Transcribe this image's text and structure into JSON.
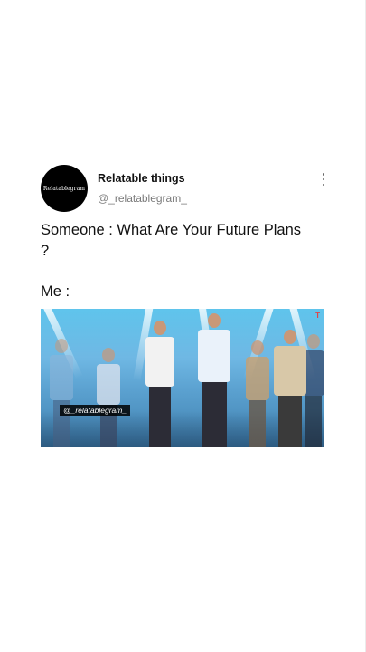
{
  "post": {
    "avatar_text": "Relatablegram",
    "display_name": "Relatable things",
    "handle": "@_relatablegram_",
    "text_line1": "Someone : What Are Your Future Plans ?",
    "text_line2": "Me :",
    "media": {
      "watermark": "@_relatablegram_",
      "corner_mark": "T",
      "description_colors": {
        "sky": "#5fc4ec",
        "floor": "#3f7fae"
      }
    }
  },
  "icons": {
    "more": "vertical-ellipsis-icon"
  }
}
